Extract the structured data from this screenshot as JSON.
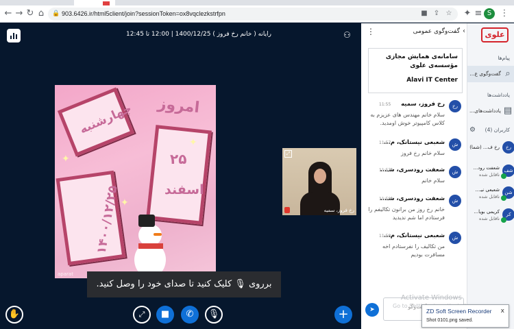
{
  "browser": {
    "url": "903.6426.ir/html5client/join?sessionToken=ox8vqclezkstrfpn",
    "profile_initial": "S"
  },
  "meeting": {
    "title": "رایانه ( خانم رخ فروز ) 1400/12/25 | 12:00 تا 12:45"
  },
  "slide": {
    "word_emrooz": "امروز",
    "word_rooz": "چهارشنبه",
    "day": "۲۵",
    "month": "اسفند",
    "date": "۱۴۰۰/۱۲/۲۵",
    "watermark": "aparat"
  },
  "webcam": {
    "name": "رخ فروز، سمیه"
  },
  "audio_prompt": "برروی 🎙 کلیک کنید تا صدای خود را وصل کنید.",
  "controls": {
    "hand_icon": "✋",
    "share_icon": "⤢",
    "video_icon": "■",
    "phone_icon": "✆",
    "mic_icon": "🎙",
    "plus_icon": "+"
  },
  "chat": {
    "title": "گفت‌وگوی عمومی",
    "welcome_line1": "سامانه‌ی همایش مجازی",
    "welcome_line2": "مؤسسه‌ی علوی",
    "welcome_line3": "Alavi IT Center",
    "messages": [
      {
        "avatar": "رخ",
        "name": "رخ فروز، سمیه",
        "time": "11:55",
        "text": "سلام خانم مهندس های عزیزم به کلاس کامپیوتر خوش اومدید."
      },
      {
        "avatar": "ش",
        "name": "شعبعی نیستانک، م...",
        "time": "11:57",
        "text": "سلام خانم رخ فروز"
      },
      {
        "avatar": "ش",
        "name": "شعفت رودسری، شـ...",
        "time": "11:57",
        "text": "سلام خانم"
      },
      {
        "avatar": "ش",
        "name": "شعفت رودسری، شـ...",
        "time": "11:58",
        "text": "خانم رخ روز من برانون تکالیفم را فرستادم اما شم ندیدید"
      },
      {
        "avatar": "ش",
        "name": "شعبعی نیستانک، م...",
        "time": "11:58",
        "text": "من تکالیف را نفرستادم اخه مسافرت بودیم"
      }
    ],
    "input_placeholder": "ارسال پیام به گفت‌وگو",
    "watermark_line1": "Activate Windows",
    "watermark_line2": "Go to Settings to activate Windows."
  },
  "sidebar": {
    "logo": "علوی",
    "messages_header": "پیام‌ها",
    "public_chat_label": "گفت‌وگوی ع...",
    "notes_header": "یادداشت‌ها",
    "shared_notes_label": "یادداشت‌های...",
    "users_header": "کاربران (4)",
    "users": [
      {
        "avatar": "رخ",
        "name": "رخ ف... (شما)",
        "status": ""
      },
      {
        "avatar": "شف",
        "name": "شعفت رود...",
        "status": "ناقابل شده"
      },
      {
        "avatar": "شن",
        "name": "شعبعی نیـ...",
        "status": "ناقابل شده"
      },
      {
        "avatar": "کر",
        "name": "کریمی بویا...",
        "status": "ناقابل شده"
      }
    ]
  },
  "toast": {
    "title": "ZD Soft Screen Recorder",
    "body": "Shot 0101.png saved.",
    "close": "x"
  },
  "colors": {
    "main_bg": "#06172d",
    "accent_blue": "#0f70d7",
    "avatar_blue": "#234fa8",
    "logo_red": "#d4232b"
  }
}
